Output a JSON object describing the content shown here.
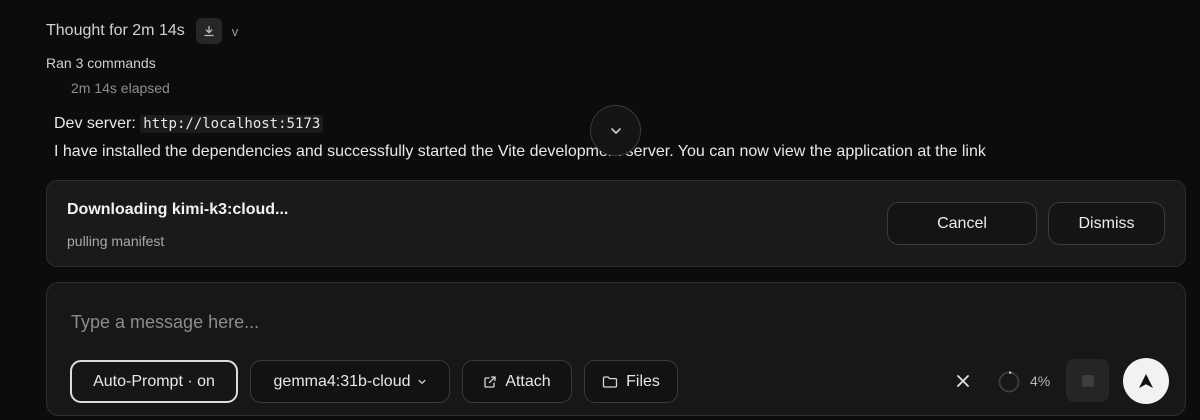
{
  "thought": {
    "title": "Thought for 2m 14s",
    "download_icon": "download-icon",
    "expand_glyph": "v"
  },
  "commands": {
    "ran_label": "Ran 3 commands",
    "elapsed": "2m 14s elapsed"
  },
  "message": {
    "dev_label": "Dev server:",
    "dev_url": "http://localhost:5173",
    "body": "I have installed the dependencies and successfully started the Vite development server. You can now view the application at the link"
  },
  "download": {
    "title": "Downloading kimi-k3:cloud...",
    "status": "pulling manifest",
    "cancel_label": "Cancel",
    "dismiss_label": "Dismiss"
  },
  "composer": {
    "placeholder": "Type a message here...",
    "auto_prompt_label": "Auto-Prompt · on",
    "model_label": "gemma4:31b-cloud",
    "attach_label": "Attach",
    "files_label": "Files",
    "context_percent": "4%",
    "context_fraction": 0.04
  },
  "colors": {
    "background": "#0c0c0c",
    "panel": "#1a1a1a",
    "send_button": "#f2f2f2"
  }
}
